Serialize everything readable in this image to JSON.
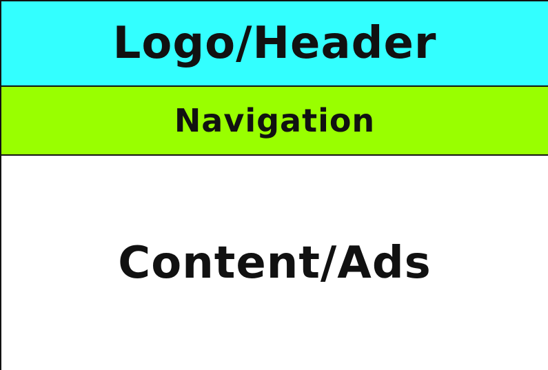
{
  "layout": {
    "header": {
      "label": "Logo/Header",
      "color": "#33ffff"
    },
    "navigation": {
      "label": "Navigation",
      "color": "#99ff00"
    },
    "content": {
      "label": "Content/Ads",
      "color": "#ffffff"
    }
  }
}
